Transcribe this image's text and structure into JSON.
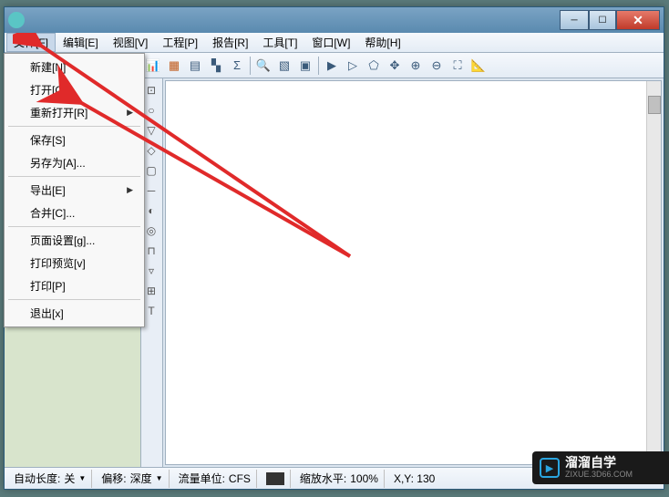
{
  "menubar": {
    "file": "文件[F]",
    "edit": "编辑[E]",
    "view": "视图[V]",
    "project": "工程[P]",
    "report": "报告[R]",
    "tools": "工具[T]",
    "window": "窗口[W]",
    "help": "帮助[H]"
  },
  "file_menu": {
    "new": "新建[N]",
    "open": "打开[O]...",
    "reopen": "重新打开[R]",
    "save": "保存[S]",
    "saveas": "另存为[A]...",
    "export": "导出[E]",
    "merge": "合并[C]...",
    "page_setup": "页面设置[g]...",
    "print_preview": "打印预览[v]",
    "print": "打印[P]",
    "exit": "退出[x]"
  },
  "side_tool": {
    "text": "T"
  },
  "statusbar": {
    "auto_length_label": "自动长度:",
    "auto_length_value": "关",
    "offset_label": "偏移:",
    "offset_value": "深度",
    "flow_unit_label": "流量单位:",
    "flow_unit_value": "CFS",
    "zoom_label": "缩放水平:",
    "zoom_value": "100%",
    "coords": "X,Y: 130"
  },
  "watermark": {
    "title": "溜溜自学",
    "sub": "ZIXUE.3D66.COM"
  }
}
